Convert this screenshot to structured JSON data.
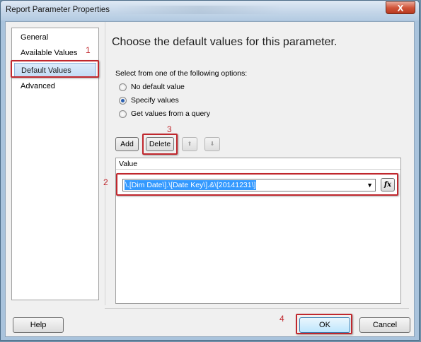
{
  "window": {
    "title": "Report Parameter Properties",
    "close_glyph": "X"
  },
  "nav": {
    "items": [
      {
        "label": "General"
      },
      {
        "label": "Available Values"
      },
      {
        "label": "Default Values"
      },
      {
        "label": "Advanced"
      }
    ],
    "selected": "Default Values"
  },
  "main": {
    "heading": "Choose the default values for this parameter.",
    "options_label": "Select from one of the following options:",
    "options": [
      {
        "label": "No default value",
        "checked": false
      },
      {
        "label": "Specify values",
        "checked": true
      },
      {
        "label": "Get values from a query",
        "checked": false
      }
    ],
    "toolbar": {
      "add_label": "Add",
      "delete_label": "Delete",
      "move_up_glyph": "⬆",
      "move_down_glyph": "⬇"
    },
    "grid": {
      "column_header": "Value",
      "value": "\\.[Dim Date\\].\\[Date Key\\].&\\[20141231\\]",
      "dropdown_glyph": "▼",
      "expression_glyph": "fx"
    }
  },
  "annotations": [
    "1",
    "2",
    "3",
    "4"
  ],
  "footer": {
    "help_label": "Help",
    "ok_label": "OK",
    "cancel_label": "Cancel"
  },
  "colors": {
    "highlight": "#c0272d",
    "selection": "#3399ff"
  }
}
